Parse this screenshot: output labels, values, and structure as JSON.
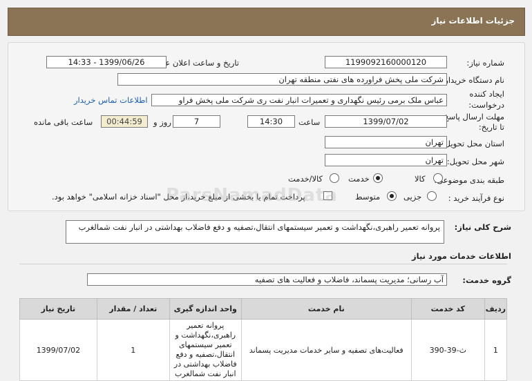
{
  "header": {
    "title": "جزئیات اطلاعات نیاز"
  },
  "fields": {
    "need_number_label": "شماره نیاز:",
    "need_number": "1199092160000120",
    "announce_label": "تاریخ و ساعت اعلان عمومی:",
    "announce_value": "1399/06/26 - 14:33",
    "buyer_label": "نام دستگاه خریدار:",
    "buyer_value": "شرکت ملی پخش فراورده های نفتی منطقه تهران",
    "creator_label_1": "ایجاد کننده",
    "creator_label_2": "درخواست:",
    "creator_value": "عباس ملک برمی رئیس نگهداری و تعمیرات انبار نفت ری شرکت ملی پخش فراو",
    "contact_link": "اطلاعات تماس خریدار",
    "deadline_label_1": "مهلت ارسال پاسخ:",
    "deadline_label_2": "تا تاریخ:",
    "deadline_date": "1399/07/02",
    "time_label": "ساعت",
    "deadline_time": "14:30",
    "days_value": "7",
    "days_label": "روز و",
    "remaining_value": "00:44:59",
    "remaining_label": "ساعت باقی مانده",
    "province_label": "استان محل تحویل:",
    "province_value": "تهران",
    "city_label": "شهر محل تحویل:",
    "city_value": "تهران",
    "category_label": "طبقه بندی موضوعی:",
    "category_options": [
      "کالا",
      "خدمت",
      "کالا/خدمت"
    ],
    "category_selected": "خدمت",
    "process_label": "نوع فرآیند خرید :",
    "process_options": [
      "جزیی",
      "متوسط"
    ],
    "process_selected": "متوسط",
    "payment_note": "پرداخت تمام یا بخشی از مبلغ خرید،از محل \"اسناد خزانه اسلامی\" خواهد بود."
  },
  "description": {
    "label": "شرح کلی نیاز:",
    "text": "پروانه تعمیر راهبری،نگهداشت و تعمیر سیستمهای انتقال،تصفیه و دفع فاضلاب بهداشتی در انبار نفت شمالغرب"
  },
  "services_section": {
    "title": "اطلاعات خدمات مورد نیاز",
    "group_label": "گروه خدمت:",
    "group_value": "آب رسانی؛ مدیریت پسماند، فاضلاب و فعالیت های تصفیه"
  },
  "table": {
    "headers": [
      "ردیف",
      "کد خدمت",
      "نام خدمت",
      "واحد اندازه گیری",
      "تعداد / مقدار",
      "تاریخ نیاز"
    ],
    "rows": [
      [
        "1",
        "ث-39-390",
        "فعالیت‌های تصفیه و سایر خدمات مدیریت پسماند",
        "پروانه تعمیر راهبری،نگهداشت و تعمیر سیستمهای انتقال،تصفیه و دفع فاضلاب بهداشتی در انبار نفت شمالغرب",
        "1",
        "1399/07/02"
      ]
    ]
  },
  "watermark": "ParsNamadData"
}
